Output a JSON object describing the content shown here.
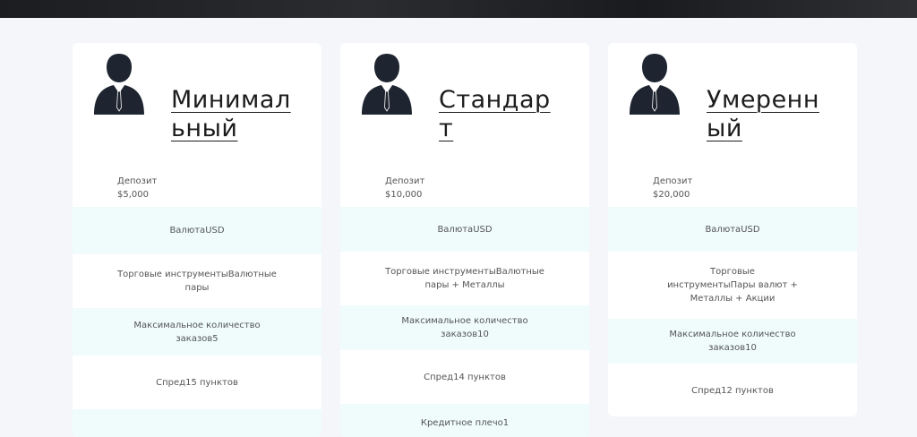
{
  "plans": [
    {
      "name": "Минимальный",
      "deposit_label": "Депозит",
      "deposit_value": "$5,000",
      "currency": "ВалютаUSD",
      "instruments": "Торговые инструментыВалютные пары",
      "max_orders": "Максимальное количество заказов5",
      "spread": "Спред15 пунктов"
    },
    {
      "name": "Стандарт",
      "deposit_label": "Депозит",
      "deposit_value": "$10,000",
      "currency": "ВалютаUSD",
      "instruments": "Торговые инструментыВалютные пары + Металлы",
      "max_orders": "Максимальное количество заказов10",
      "spread": "Спред14 пунктов",
      "leverage": "Кредитное плечо1"
    },
    {
      "name": "Умеренный",
      "deposit_label": "Депозит",
      "deposit_value": "$20,000",
      "currency": "ВалютаUSD",
      "instruments": "Торговые инструментыПары валют + Металлы + Акции",
      "max_orders": "Максимальное количество заказов10",
      "spread": "Спред12 пунктов"
    }
  ]
}
